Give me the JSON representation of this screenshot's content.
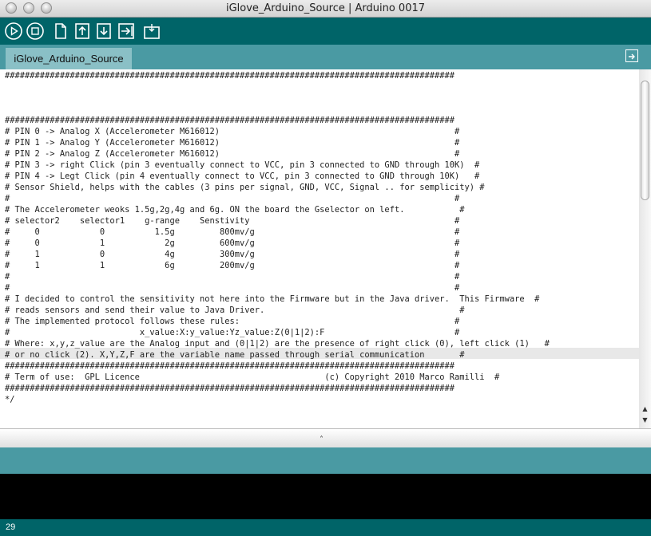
{
  "window": {
    "title": "iGlove_Arduino_Source | Arduino 0017"
  },
  "toolbar": {
    "buttons": [
      "verify-icon",
      "stop-icon",
      "new-icon",
      "open-icon",
      "save-icon",
      "upload-icon",
      "serial-monitor-icon"
    ]
  },
  "tabs": [
    {
      "label": "iGlove_Arduino_Source"
    }
  ],
  "editor": {
    "lines": [
      "##########################################################################################",
      "",
      "",
      "",
      "##########################################################################################",
      "# PIN 0 -> Analog X (Accelerometer M616012)                                               #",
      "# PIN 1 -> Analog Y (Accelerometer M616012)                                               #",
      "# PIN 2 -> Analog Z (Accelerometer M616012)                                               #",
      "# PIN 3 -> right Click (pin 3 eventually connect to VCC, pin 3 connected to GND through 10K)  #",
      "# PIN 4 -> Legt Click (pin 4 eventually connect to VCC, pin 3 connected to GND through 10K)   #",
      "# Sensor Shield, helps with the cables (3 pins per signal, GND, VCC, Signal .. for semplicity) #",
      "#                                                                                         #",
      "# The Accelerometer weoks 1.5g,2g,4g and 6g. ON the board the Gselector on left.           #",
      "# selector2    selector1    g-range    Senstivity                                         #",
      "#     0            0          1.5g         800mv/g                                        #",
      "#     0            1            2g         600mv/g                                        #",
      "#     1            0            4g         300mv/g                                        #",
      "#     1            1            6g         200mv/g                                        #",
      "#                                                                                         #",
      "#                                                                                         #",
      "# I decided to control the sensitivity not here into the Firmware but in the Java driver.  This Firmware  #",
      "# reads sensors and send their value to Java Driver.                                       #",
      "# The implemented protocol follows these rules:                                           #",
      "#                          x_value:X:y_value:Yz_value:Z(0|1|2):F                          #",
      "# Where: x,y,z_value are the Analog input and (0|1|2) are the presence of right click (0), left click (1)   #",
      "# or no click (2). X,Y,Z,F are the variable name passed through serial communication       #",
      "##########################################################################################",
      "# Term of use:  GPL Licence                                     (c) Copyright 2010 Marco Ramilli  #",
      "##########################################################################################",
      "*/"
    ]
  },
  "status": {
    "line_number": "29"
  }
}
